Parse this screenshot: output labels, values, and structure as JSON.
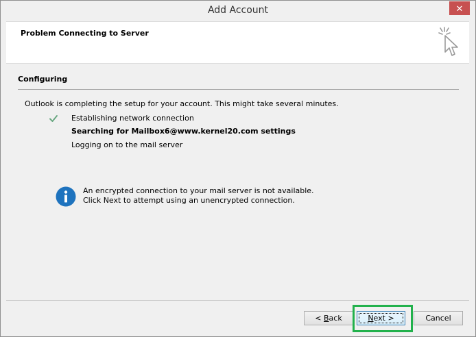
{
  "window": {
    "title": "Add Account",
    "close_glyph": "✕"
  },
  "header": {
    "heading": "Problem Connecting to Server",
    "icon": "wizard-cursor-icon"
  },
  "section": {
    "title": "Configuring",
    "intro": "Outlook is completing the setup for your account. This might take several minutes."
  },
  "steps": [
    {
      "label": "Establishing network connection",
      "status": "done"
    },
    {
      "label": "Searching for Mailbox6@www.kernel20.com settings",
      "status": "current"
    },
    {
      "label": "Logging on to the mail server",
      "status": "pending"
    }
  ],
  "info": {
    "icon": "info-icon",
    "line1": "An encrypted connection to your mail server is not available.",
    "line2": "Click Next to attempt using an unencrypted connection."
  },
  "buttons": {
    "back_prefix": "< ",
    "back_accel": "B",
    "back_rest": "ack",
    "next_accel": "N",
    "next_rest": "ext >",
    "cancel": "Cancel"
  },
  "colors": {
    "highlight": "#22b14c",
    "close": "#c75050",
    "check": "#6aa882",
    "info": "#1e73be"
  }
}
